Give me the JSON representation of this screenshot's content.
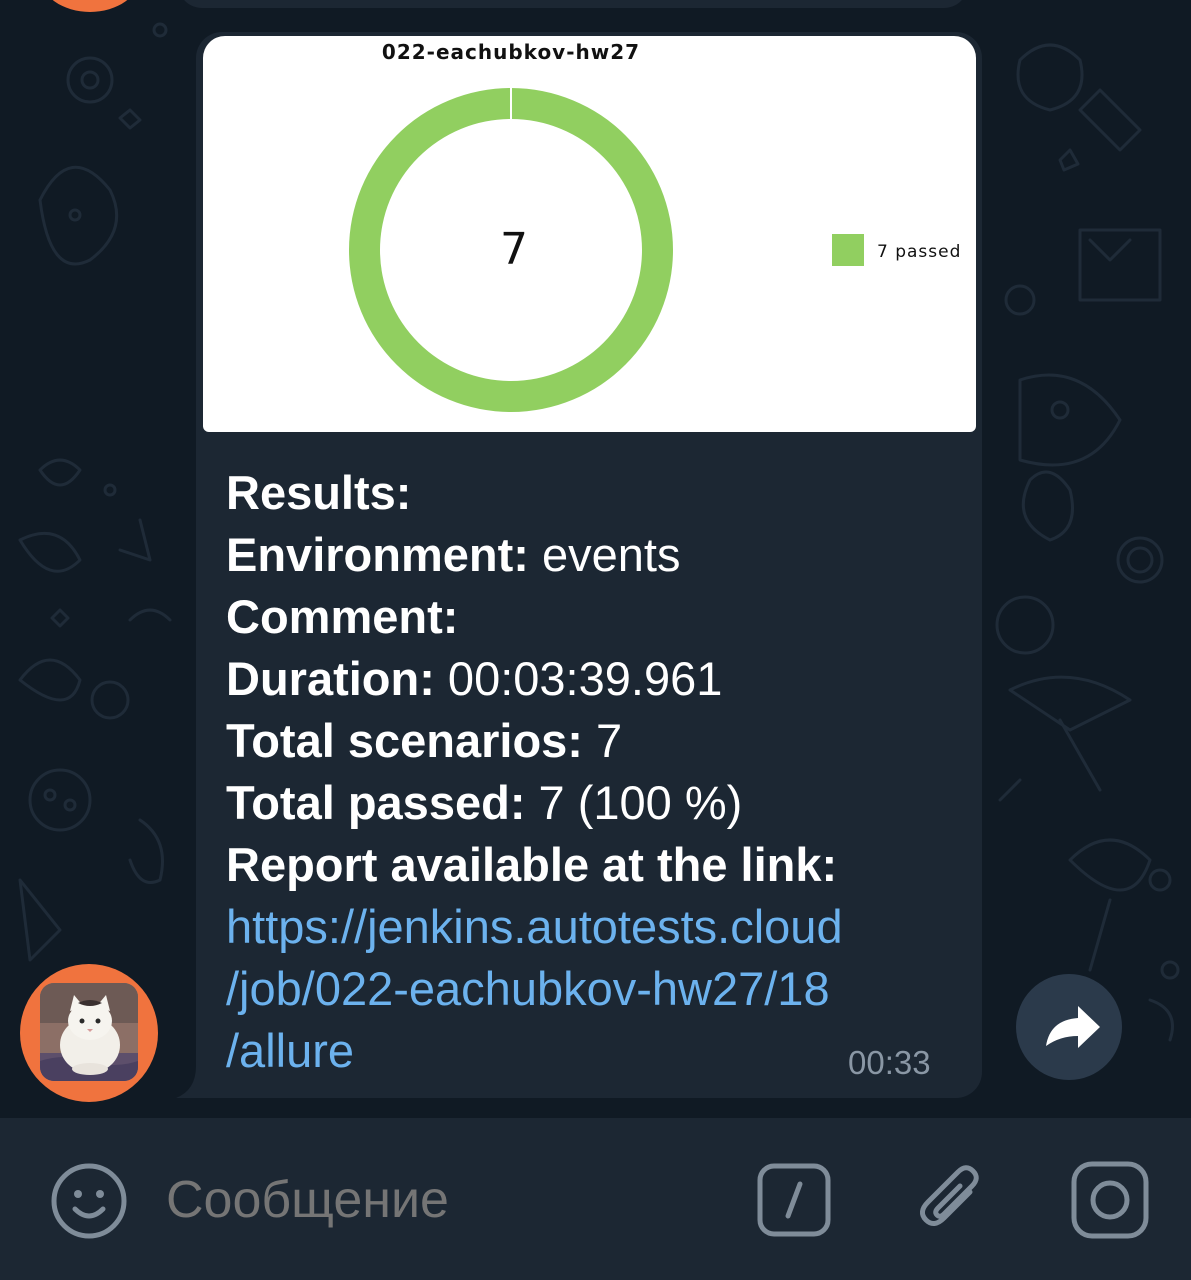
{
  "chat": {
    "message": {
      "chart_image": {
        "chart_data": {
          "type": "pie",
          "title": "022-eachubkov-hw27",
          "center_label": "7",
          "slices": [
            {
              "name": "7 passed",
              "value": 7,
              "color": "#91cf60"
            }
          ],
          "legend_position": "right"
        }
      },
      "results_label": "Results:",
      "environment_label": "Environment:",
      "environment_value": " events",
      "comment_label": "Comment:",
      "duration_label": "Duration:",
      "duration_value": " 00:03:39.961",
      "total_scenarios_label": "Total scenarios:",
      "total_scenarios_value": " 7",
      "total_passed_label": "Total passed:",
      "total_passed_value": " 7 (100 %)",
      "report_label": "Report available at the link:",
      "link_line1": "https://jenkins.autotests.cloud",
      "link_line2": "/job/022-eachubkov-hw27/18",
      "link_line3": "/allure",
      "time": "00:33"
    },
    "avatar_icon": "cat-photo-avatar",
    "share_icon": "share-arrow-icon"
  },
  "input_bar": {
    "placeholder": "Сообщение",
    "emoji_icon": "emoji-icon",
    "commands_icon": "slash-commands-icon",
    "attach_icon": "paperclip-icon",
    "camera_icon": "camera-icon"
  },
  "colors": {
    "background": "#101a24",
    "bubble": "#1c2733",
    "link": "#6cb2ee",
    "avatar_ring": "#f0733e",
    "passed": "#91cf60"
  }
}
